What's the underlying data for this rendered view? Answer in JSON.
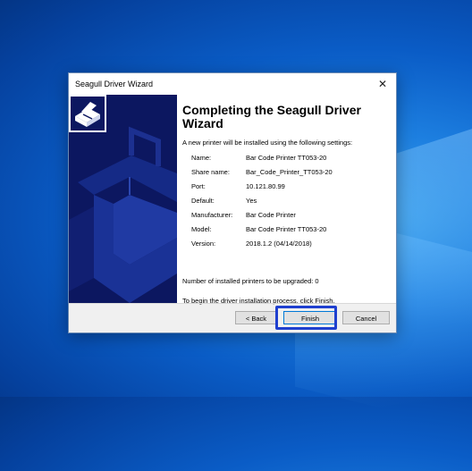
{
  "window": {
    "title": "Seagull Driver Wizard",
    "close_glyph": "✕"
  },
  "heading": "Completing the Seagull Driver Wizard",
  "intro": "A new printer will be installed using the following settings:",
  "settings": [
    {
      "label": "Name:",
      "value": "Bar Code Printer TT053-20"
    },
    {
      "label": "Share name:",
      "value": "Bar_Code_Printer_TT053-20"
    },
    {
      "label": "Port:",
      "value": "10.121.80.99"
    },
    {
      "label": "Default:",
      "value": "Yes"
    },
    {
      "label": "Manufacturer:",
      "value": "Bar Code Printer"
    },
    {
      "label": "Model:",
      "value": "Bar Code Printer TT053-20"
    },
    {
      "label": "Version:",
      "value": "2018.1.2 (04/14/2018)"
    }
  ],
  "upgrade_text": "Number of installed printers to be upgraded:  0",
  "begin_text": "To begin the driver installation process, click Finish.",
  "buttons": {
    "back": "< Back",
    "finish": "Finish",
    "cancel": "Cancel"
  },
  "icons": {
    "logo": "printer-logo-icon",
    "close": "close-icon"
  },
  "colors": {
    "banner": "#0c1760",
    "highlight": "#1f3fcf",
    "desktop": "#0a5cc6"
  }
}
